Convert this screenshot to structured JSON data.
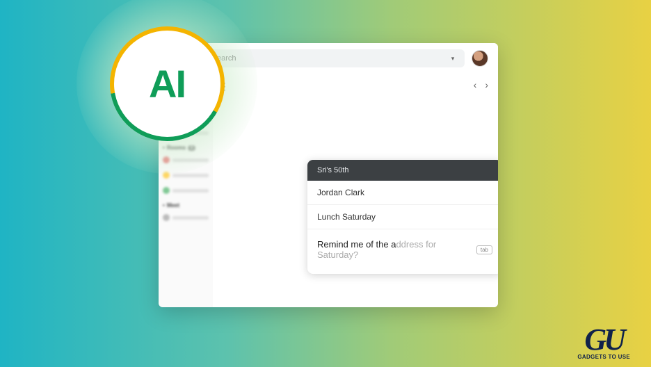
{
  "badge": {
    "label": "AI"
  },
  "header": {
    "search_placeholder": "earch"
  },
  "sidebar": {
    "sections": {
      "rooms_label": "Rooms",
      "rooms_badge": "1",
      "meet_label": "Meet"
    }
  },
  "compose": {
    "title": "Sri's 50th",
    "to": "Jordan Clark",
    "subject": "Lunch Saturday",
    "body_typed": "Remind me of the a",
    "body_suggest": "ddress for Saturday?",
    "tab_hint": "tab"
  },
  "watermark": {
    "logo": "GU",
    "text": "GADGETS TO USE"
  }
}
